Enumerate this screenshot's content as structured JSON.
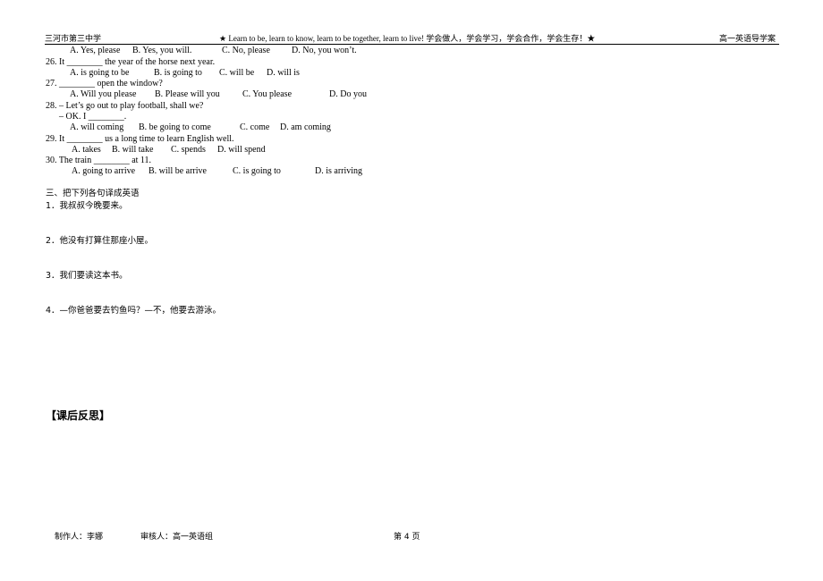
{
  "header": {
    "school": "三河市第三中学",
    "motto": "★  Learn to be, learn to know, learn to be together, learn to live!   学会做人，学会学习，学会合作，学会生存！★",
    "doc_title": "高一英语导学案"
  },
  "questions": [
    {
      "number": "",
      "stem": "",
      "options": [
        "A. Yes, please",
        "B. Yes, you will.",
        "C. No, please",
        "D. No, you won’t."
      ]
    },
    {
      "number": "26.",
      "stem": "26. It ________ the year of the horse next year.",
      "options": [
        "A. is going to be",
        "B. is going to",
        "C. will be",
        "D. will is"
      ]
    },
    {
      "number": "27.",
      "stem": "27. ________ open the window?",
      "options": [
        "A. Will you please",
        "B. Please will you",
        "C. You please",
        "D. Do you"
      ]
    },
    {
      "number": "28.",
      "stem": "28. – Let’s go out to play football, shall we?",
      "stem2": "– OK. I ________.",
      "options": [
        "A. will coming",
        "B. be going to come",
        "C. come",
        "D. am coming"
      ]
    },
    {
      "number": "29.",
      "stem": "29. It ________ us a long time to learn English well.",
      "options": [
        "A. takes",
        "B. will take",
        "C. spends",
        "D. will spend"
      ]
    },
    {
      "number": "30.",
      "stem": "30. The train ________ at 11.",
      "options": [
        "A. going to arrive",
        "B. will be arrive",
        "C. is going to",
        "D. is arriving"
      ]
    }
  ],
  "section3": {
    "title": "三、把下列各句译成英语",
    "items": [
      "1．我叔叔今晚要来。",
      "2．他没有打算住那座小屋。",
      "3．我们要读这本书。",
      "4．—你爸爸要去钓鱼吗？—不，他要去游泳。"
    ]
  },
  "reflection": "【课后反思】",
  "footer": {
    "author": "制作人：李娜",
    "reviewer": "审核人：高一英语组",
    "page": "第 4 页"
  }
}
